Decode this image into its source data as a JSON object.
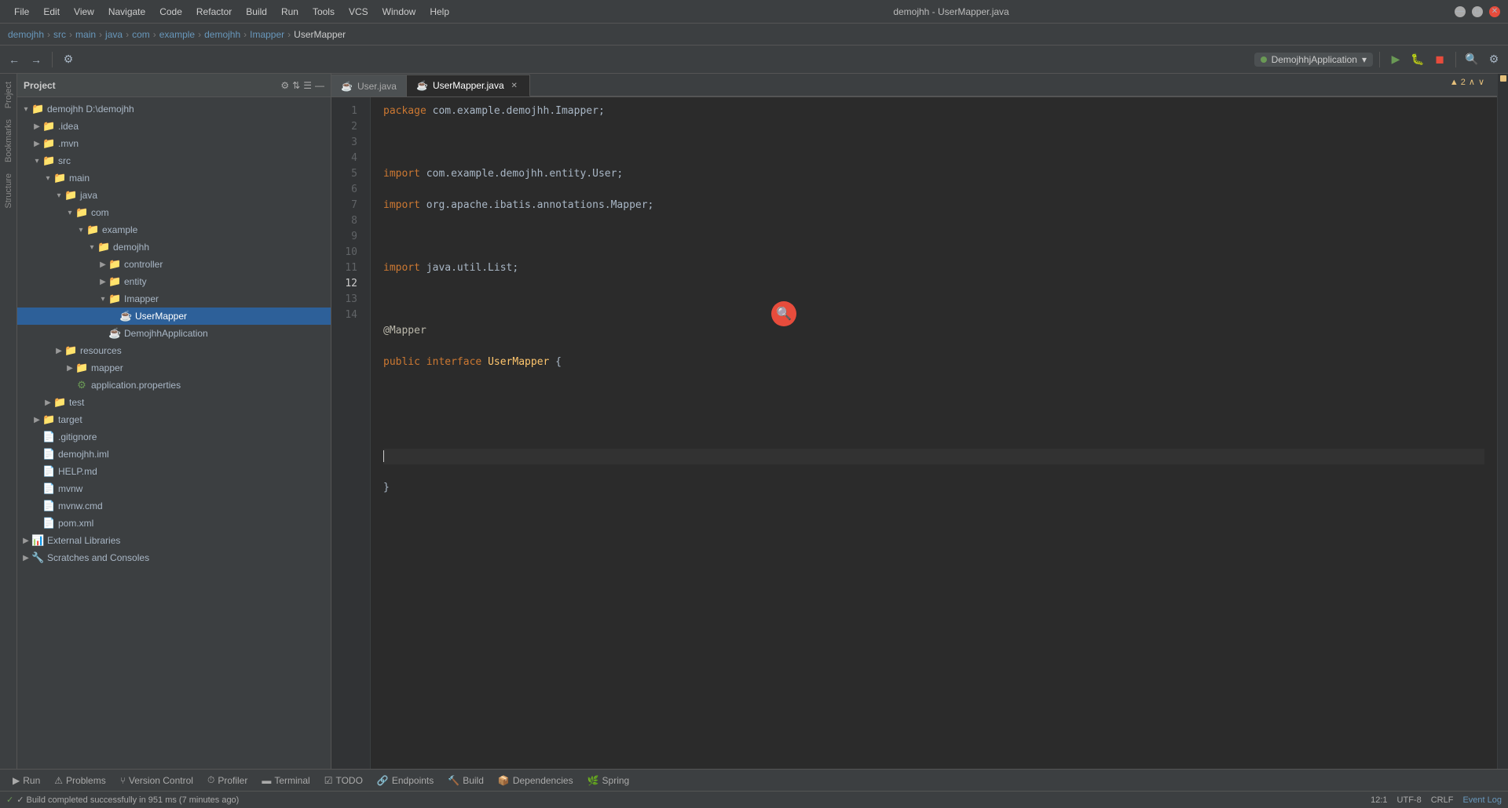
{
  "window": {
    "title": "demojhh - UserMapper.java"
  },
  "menubar": {
    "items": [
      "File",
      "Edit",
      "View",
      "Navigate",
      "Code",
      "Refactor",
      "Build",
      "Run",
      "Tools",
      "VCS",
      "Window",
      "Help"
    ]
  },
  "breadcrumb": {
    "items": [
      "demojhh",
      "src",
      "main",
      "java",
      "com",
      "example",
      "demojhh",
      "Imapper"
    ],
    "current": "UserMapper"
  },
  "toolbar": {
    "run_config": "DemojhhjApplication",
    "run_label": "DemojhhjApplication"
  },
  "project_panel": {
    "title": "Project",
    "dropdown": "▾"
  },
  "tree": [
    {
      "id": "demojhh-root",
      "indent": 0,
      "arrow": "▾",
      "icon": "📁",
      "icon_class": "icon-folder",
      "label": "demojhh",
      "suffix": " D:\\demojhh",
      "selected": false
    },
    {
      "id": "idea",
      "indent": 1,
      "arrow": "▶",
      "icon": "📁",
      "icon_class": "icon-folder",
      "label": ".idea",
      "suffix": "",
      "selected": false
    },
    {
      "id": "mvn",
      "indent": 1,
      "arrow": "▶",
      "icon": "📁",
      "icon_class": "icon-folder",
      "label": ".mvn",
      "suffix": "",
      "selected": false
    },
    {
      "id": "src",
      "indent": 1,
      "arrow": "▾",
      "icon": "📁",
      "icon_class": "icon-folder",
      "label": "src",
      "suffix": "",
      "selected": false
    },
    {
      "id": "main",
      "indent": 2,
      "arrow": "▾",
      "icon": "📁",
      "icon_class": "icon-folder",
      "label": "main",
      "suffix": "",
      "selected": false
    },
    {
      "id": "java",
      "indent": 3,
      "arrow": "▾",
      "icon": "📁",
      "icon_class": "icon-folder",
      "label": "java",
      "suffix": "",
      "selected": false
    },
    {
      "id": "com",
      "indent": 4,
      "arrow": "▾",
      "icon": "📁",
      "icon_class": "icon-folder",
      "label": "com",
      "suffix": "",
      "selected": false
    },
    {
      "id": "example",
      "indent": 5,
      "arrow": "▾",
      "icon": "📁",
      "icon_class": "icon-folder",
      "label": "example",
      "suffix": "",
      "selected": false
    },
    {
      "id": "demojhh2",
      "indent": 6,
      "arrow": "▾",
      "icon": "📁",
      "icon_class": "icon-folder",
      "label": "demojhh",
      "suffix": "",
      "selected": false
    },
    {
      "id": "controller",
      "indent": 7,
      "arrow": "▶",
      "icon": "📁",
      "icon_class": "icon-folder",
      "label": "controller",
      "suffix": "",
      "selected": false
    },
    {
      "id": "entity",
      "indent": 7,
      "arrow": "▶",
      "icon": "📁",
      "icon_class": "icon-folder",
      "label": "entity",
      "suffix": "",
      "selected": false
    },
    {
      "id": "imapper",
      "indent": 7,
      "arrow": "▾",
      "icon": "📁",
      "icon_class": "icon-folder",
      "label": "Imapper",
      "suffix": "",
      "selected": false
    },
    {
      "id": "usermapper",
      "indent": 8,
      "arrow": "",
      "icon": "☕",
      "icon_class": "icon-java",
      "label": "UserMapper",
      "suffix": "",
      "selected": true
    },
    {
      "id": "demojhhapp",
      "indent": 7,
      "arrow": "",
      "icon": "☕",
      "icon_class": "icon-spring",
      "label": "DemojhhApplication",
      "suffix": "",
      "selected": false
    },
    {
      "id": "resources",
      "indent": 3,
      "arrow": "▶",
      "icon": "📁",
      "icon_class": "icon-folder",
      "label": "resources",
      "suffix": "",
      "selected": false
    },
    {
      "id": "mapper-res",
      "indent": 4,
      "arrow": "▶",
      "icon": "📁",
      "icon_class": "icon-folder",
      "label": "mapper",
      "suffix": "",
      "selected": false
    },
    {
      "id": "appprop",
      "indent": 4,
      "arrow": "",
      "icon": "⚙",
      "icon_class": "icon-props",
      "label": "application.properties",
      "suffix": "",
      "selected": false
    },
    {
      "id": "test",
      "indent": 2,
      "arrow": "▶",
      "icon": "📁",
      "icon_class": "icon-folder",
      "label": "test",
      "suffix": "",
      "selected": false
    },
    {
      "id": "target",
      "indent": 1,
      "arrow": "▶",
      "icon": "📁",
      "icon_class": "icon-folder",
      "label": "target",
      "suffix": "",
      "selected": false
    },
    {
      "id": "gitignore",
      "indent": 1,
      "arrow": "",
      "icon": "📄",
      "icon_class": "",
      "label": ".gitignore",
      "suffix": "",
      "selected": false
    },
    {
      "id": "demojhh-iml",
      "indent": 1,
      "arrow": "",
      "icon": "📄",
      "icon_class": "icon-iml",
      "label": "demojhh.iml",
      "suffix": "",
      "selected": false
    },
    {
      "id": "help-md",
      "indent": 1,
      "arrow": "",
      "icon": "📄",
      "icon_class": "icon-md",
      "label": "HELP.md",
      "suffix": "",
      "selected": false
    },
    {
      "id": "mvnw",
      "indent": 1,
      "arrow": "",
      "icon": "📄",
      "icon_class": "",
      "label": "mvnw",
      "suffix": "",
      "selected": false
    },
    {
      "id": "mvnw-cmd",
      "indent": 1,
      "arrow": "",
      "icon": "📄",
      "icon_class": "",
      "label": "mvnw.cmd",
      "suffix": "",
      "selected": false
    },
    {
      "id": "pom-xml",
      "indent": 1,
      "arrow": "",
      "icon": "📄",
      "icon_class": "icon-xml",
      "label": "pom.xml",
      "suffix": "",
      "selected": false
    },
    {
      "id": "ext-libs",
      "indent": 0,
      "arrow": "▶",
      "icon": "📊",
      "icon_class": "",
      "label": "External Libraries",
      "suffix": "",
      "selected": false
    },
    {
      "id": "scratches",
      "indent": 0,
      "arrow": "▶",
      "icon": "🔧",
      "icon_class": "icon-scratch",
      "label": "Scratches and Consoles",
      "suffix": "",
      "selected": false
    }
  ],
  "tabs": [
    {
      "id": "user-tab",
      "label": "User.java",
      "icon": "☕",
      "active": false,
      "modified": false
    },
    {
      "id": "usermapper-tab",
      "label": "UserMapper.java",
      "icon": "☕",
      "active": true,
      "modified": false
    }
  ],
  "code": {
    "lines": [
      {
        "num": 1,
        "text": "package com.example.demojhh.Imapper;",
        "active": false
      },
      {
        "num": 2,
        "text": "",
        "active": false
      },
      {
        "num": 3,
        "text": "import com.example.demojhh.entity.User;",
        "active": false
      },
      {
        "num": 4,
        "text": "import org.apache.ibatis.annotations.Mapper;",
        "active": false
      },
      {
        "num": 5,
        "text": "",
        "active": false
      },
      {
        "num": 6,
        "text": "import java.util.List;",
        "active": false
      },
      {
        "num": 7,
        "text": "",
        "active": false
      },
      {
        "num": 8,
        "text": "@Mapper",
        "active": false
      },
      {
        "num": 9,
        "text": "public interface UserMapper {",
        "active": false
      },
      {
        "num": 10,
        "text": "",
        "active": false
      },
      {
        "num": 11,
        "text": "",
        "active": false
      },
      {
        "num": 12,
        "text": "",
        "active": true
      },
      {
        "num": 13,
        "text": "}",
        "active": false
      },
      {
        "num": 14,
        "text": "",
        "active": false
      }
    ],
    "cursor": "12:1"
  },
  "warnings": {
    "count": "▲ 2",
    "arrows": "∧ ∨"
  },
  "bottom_tools": [
    {
      "id": "run",
      "icon": "▶",
      "label": "Run",
      "active": false
    },
    {
      "id": "problems",
      "icon": "⚠",
      "label": "Problems",
      "active": false
    },
    {
      "id": "version-control",
      "icon": "⑂",
      "label": "Version Control",
      "active": false
    },
    {
      "id": "profiler",
      "icon": "⏱",
      "label": "Profiler",
      "active": false
    },
    {
      "id": "terminal",
      "icon": "▬",
      "label": "Terminal",
      "active": false
    },
    {
      "id": "todo",
      "icon": "☑",
      "label": "TODO",
      "active": false
    },
    {
      "id": "endpoints",
      "icon": "🔗",
      "label": "Endpoints",
      "active": false
    },
    {
      "id": "build",
      "icon": "🔨",
      "label": "Build",
      "active": false
    },
    {
      "id": "dependencies",
      "icon": "📦",
      "label": "Dependencies",
      "active": false
    },
    {
      "id": "spring",
      "icon": "🌿",
      "label": "Spring",
      "active": false
    }
  ],
  "status_bar": {
    "message": "✓ Build completed successfully in 951 ms (7 minutes ago)",
    "cursor_pos": "12:1",
    "encoding": "UTF-8",
    "line_sep": "CRLF",
    "event_log": "Event Log"
  },
  "vertical_tools": {
    "items": [
      "Project",
      "Bookmarks",
      "Structure"
    ]
  }
}
